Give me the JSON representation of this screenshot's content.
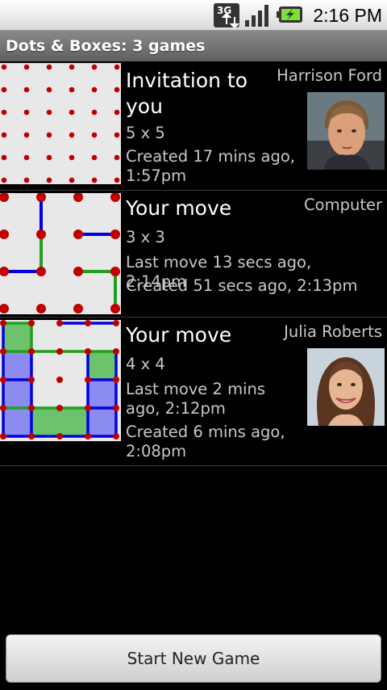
{
  "status_bar": {
    "network_label": "3G",
    "time": "2:16 PM",
    "icons": [
      "3g-data-icon",
      "signal-icon",
      "battery-icon"
    ]
  },
  "title": "Dots & Boxes: 3 games",
  "games": [
    {
      "status": "Invitation to you",
      "opponent": "Harrison Ford",
      "size": "5 x 5",
      "last_move": "",
      "created": "Created 17 mins ago, 1:57pm",
      "has_avatar": true
    },
    {
      "status": "Your move",
      "opponent": "Computer",
      "size": "3 x 3",
      "last_move": "Last move 13 secs ago, 2:14pm",
      "created": "Created 51 secs ago, 2:13pm",
      "has_avatar": false
    },
    {
      "status": "Your move",
      "opponent": "Julia Roberts",
      "size": "4 x 4",
      "last_move": "Last move 2 mins ago, 2:12pm",
      "created": "Created 6 mins ago, 2:08pm",
      "has_avatar": true
    }
  ],
  "new_game_button": "Start New Game",
  "colors": {
    "dot": "#c00000",
    "line_player": "#0000e0",
    "line_opponent": "#1fa01f",
    "box_player": "#8b8bf0",
    "box_opponent": "#6cc36c"
  }
}
